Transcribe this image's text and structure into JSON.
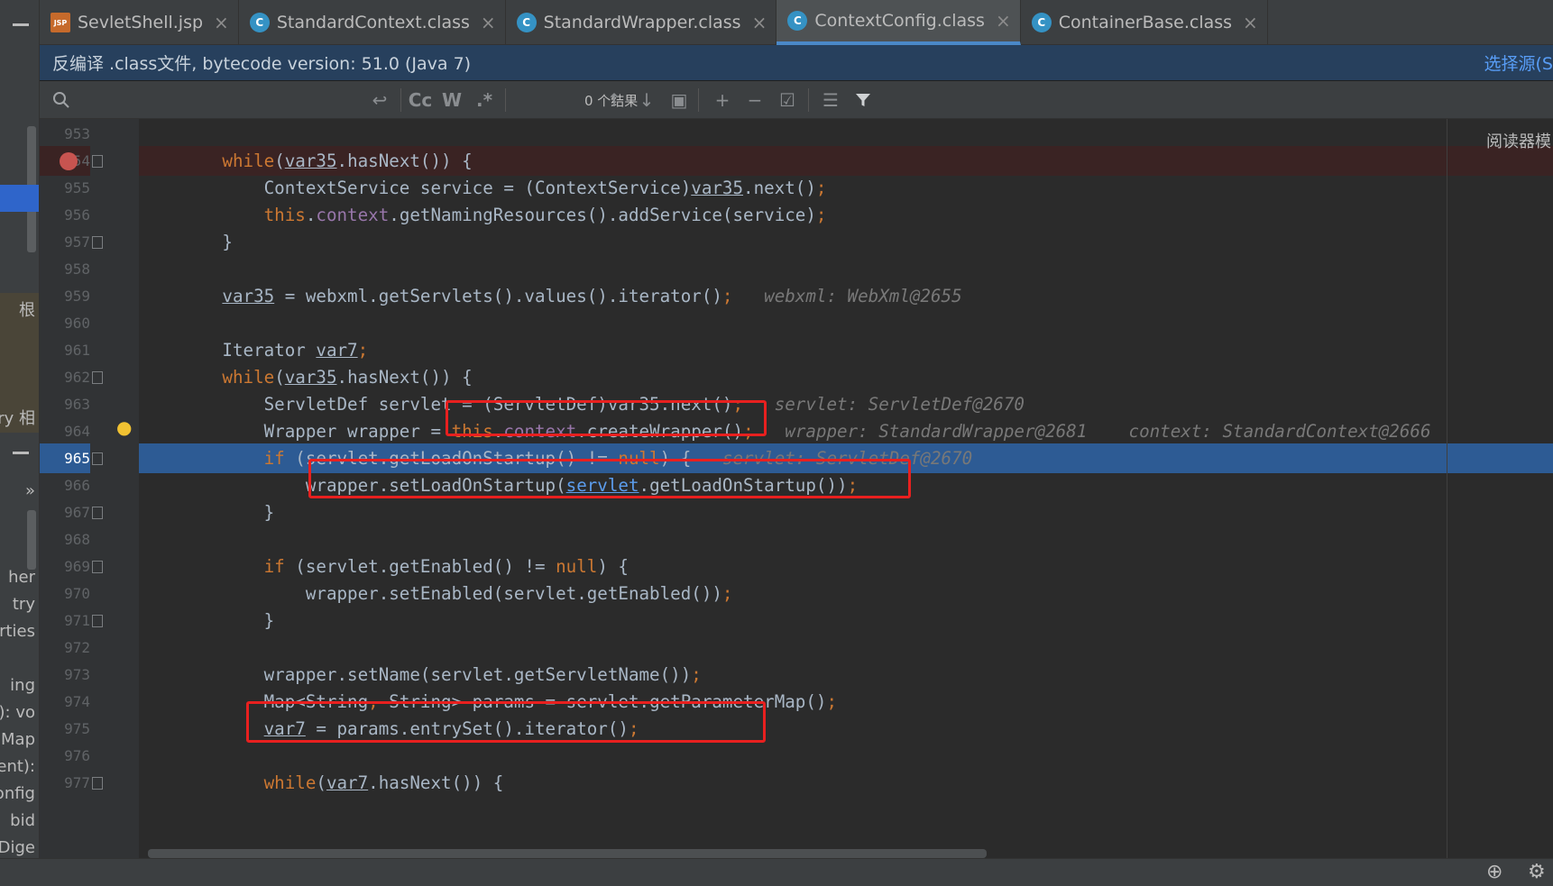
{
  "tabs": [
    {
      "label": "SevletShell.jsp",
      "icon": "jsp-file-icon",
      "active": false
    },
    {
      "label": "StandardContext.class",
      "icon": "class-file-icon",
      "active": false
    },
    {
      "label": "StandardWrapper.class",
      "icon": "class-file-icon",
      "active": false
    },
    {
      "label": "ContextConfig.class",
      "icon": "class-file-icon",
      "active": true
    },
    {
      "label": "ContainerBase.class",
      "icon": "class-file-icon",
      "active": false
    }
  ],
  "tab_icon_glyphs": {
    "jsp": "JSP",
    "class": "C"
  },
  "info_bar": {
    "text": "反编译 .class文件, bytecode version: 51.0 (Java 7)",
    "link": "选择源(S"
  },
  "search": {
    "results": "0 个结果",
    "match_case": "Cc",
    "words": "W",
    "regex": ".*"
  },
  "reader_mode": "阅读器模",
  "left_panel": {
    "labels": [
      "根",
      "ary 相",
      "»",
      "her",
      "try",
      "rties",
      "ing",
      "g): vo",
      "s(Map",
      "vent):",
      "Config",
      "bid",
      "Dige"
    ]
  },
  "lines": [
    {
      "num": "953"
    },
    {
      "num": "954"
    },
    {
      "num": "955"
    },
    {
      "num": "956"
    },
    {
      "num": "957"
    },
    {
      "num": "958"
    },
    {
      "num": "959"
    },
    {
      "num": "960"
    },
    {
      "num": "961"
    },
    {
      "num": "962"
    },
    {
      "num": "963"
    },
    {
      "num": "964"
    },
    {
      "num": "965"
    },
    {
      "num": "966"
    },
    {
      "num": "967"
    },
    {
      "num": "968"
    },
    {
      "num": "969"
    },
    {
      "num": "970"
    },
    {
      "num": "971"
    },
    {
      "num": "972"
    },
    {
      "num": "973"
    },
    {
      "num": "974"
    },
    {
      "num": "975"
    },
    {
      "num": "976"
    },
    {
      "num": "977"
    }
  ],
  "code": {
    "l954": {
      "kw": "while",
      "a": "(",
      "v": "var35",
      "b": ".hasNext()) {"
    },
    "l955": {
      "a": "ContextService service = (ContextService)",
      "v": "var35",
      "b": ".next()",
      "semi": ";"
    },
    "l956": {
      "kw": "this",
      "dot": ".",
      "fld": "context",
      "b": ".getNamingResources().addService(service)",
      "semi": ";"
    },
    "l957": {
      "a": "}"
    },
    "l959": {
      "v": "var35",
      "a": " = webxml.getServlets().values().iterator()",
      "semi": ";",
      "hint": "webxml: WebXml@2655"
    },
    "l961": {
      "a": "Iterator ",
      "v": "var7",
      "semi": ";"
    },
    "l962": {
      "kw": "while",
      "a": "(",
      "v": "var35",
      "b": ".hasNext()) {"
    },
    "l963": {
      "a": "ServletDef servlet = (ServletDef)",
      "v": "var35",
      "b": ".next()",
      "semi": ";",
      "hint": "servlet: ServletDef@2670"
    },
    "l964": {
      "a": "Wrapper wrapper = ",
      "kw": "this",
      "dot": ".",
      "fld": "context",
      "b": ".createWrapper()",
      "semi": ";",
      "hint1": "wrapper: StandardWrapper@2681",
      "hint2": "context: StandardContext@2666"
    },
    "l965": {
      "kw": "if",
      "a": " (servlet.getLoadOnStartup() != ",
      "kw2": "null",
      "b": ") {",
      "hint": "servlet: ServletDef@2670"
    },
    "l966": {
      "a": "wrapper.setLoadOnStartup(",
      "ul": "servlet",
      "b": ".getLoadOnStartup())",
      "semi": ";"
    },
    "l967": {
      "a": "}"
    },
    "l969": {
      "kw": "if",
      "a": " (servlet.getEnabled() != ",
      "kw2": "null",
      "b": ") {"
    },
    "l970": {
      "a": "wrapper.setEnabled(servlet.getEnabled())",
      "semi": ";"
    },
    "l971": {
      "a": "}"
    },
    "l973": {
      "a": "wrapper.setName(servlet.getServletName())",
      "semi": ";"
    },
    "l974": {
      "a": "Map<String",
      "comma": ",",
      "b": " String> params = servlet.getParameterMap()",
      "semi": ";"
    },
    "l975": {
      "v": "var7",
      "a": " = params.entrySet().iterator()",
      "semi": ";"
    },
    "l977": {
      "kw": "while",
      "a": "(",
      "v": "var7",
      "b": ".hasNext()) {"
    }
  },
  "colors": {
    "keyword": "#cc7832",
    "field": "#9876aa",
    "hint": "#787878",
    "exec_line": "#2d5b94",
    "annotation_box": "#e8201f"
  }
}
